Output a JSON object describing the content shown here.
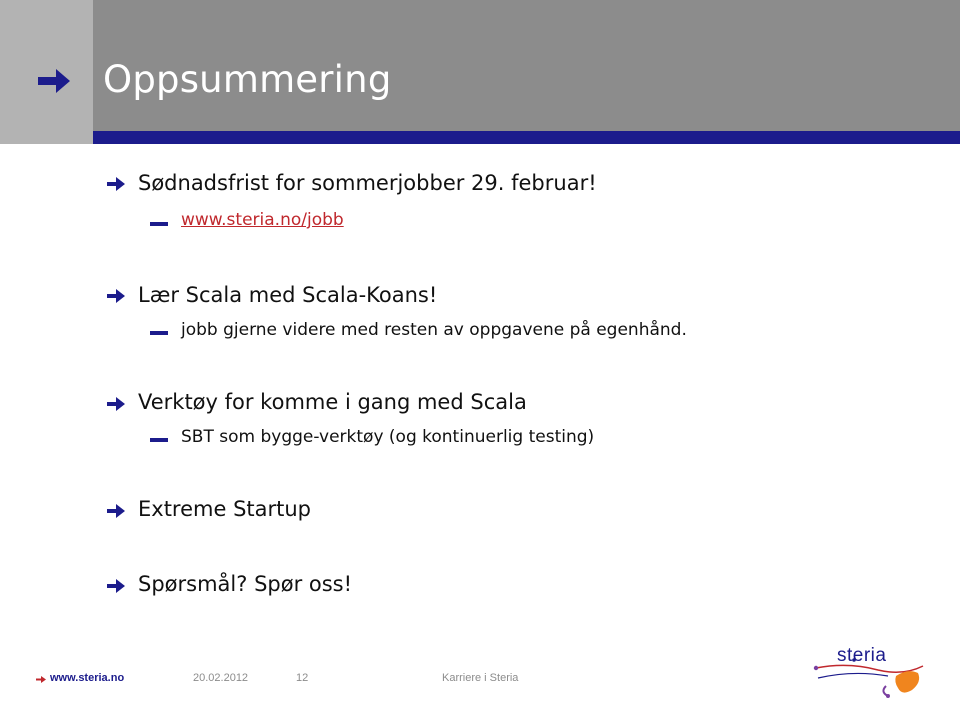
{
  "header": {
    "title": "Oppsummering",
    "accent_color": "#1c1c8c",
    "background_color": "#8c8c8c"
  },
  "bullets": [
    {
      "text": "Sødnadsfrist for sommerjobber 29. februar!",
      "sub": [
        {
          "text": "www.steria.no/jobb",
          "is_link": true
        }
      ]
    },
    {
      "text": "Lær Scala med Scala-Koans!",
      "sub": [
        {
          "text": "jobb gjerne videre med resten av oppgavene på egenhånd.",
          "is_link": false
        }
      ]
    },
    {
      "text": "Verktøy for komme i gang med Scala",
      "sub": [
        {
          "text": "SBT som bygge-verktøy (og kontinuerlig testing)",
          "is_link": false
        }
      ]
    },
    {
      "text": "Extreme Startup",
      "sub": []
    },
    {
      "text": "Spørsmål? Spør oss!",
      "sub": []
    }
  ],
  "footer": {
    "site": "www.steria.no",
    "date": "20.02.2012",
    "page": "12",
    "topic": "Karriere i Steria"
  },
  "logo": {
    "text": "steria",
    "icon": "steria-logo"
  },
  "icons": {
    "bullet": "arrow-right-icon",
    "sub_bullet": "dash-icon"
  }
}
